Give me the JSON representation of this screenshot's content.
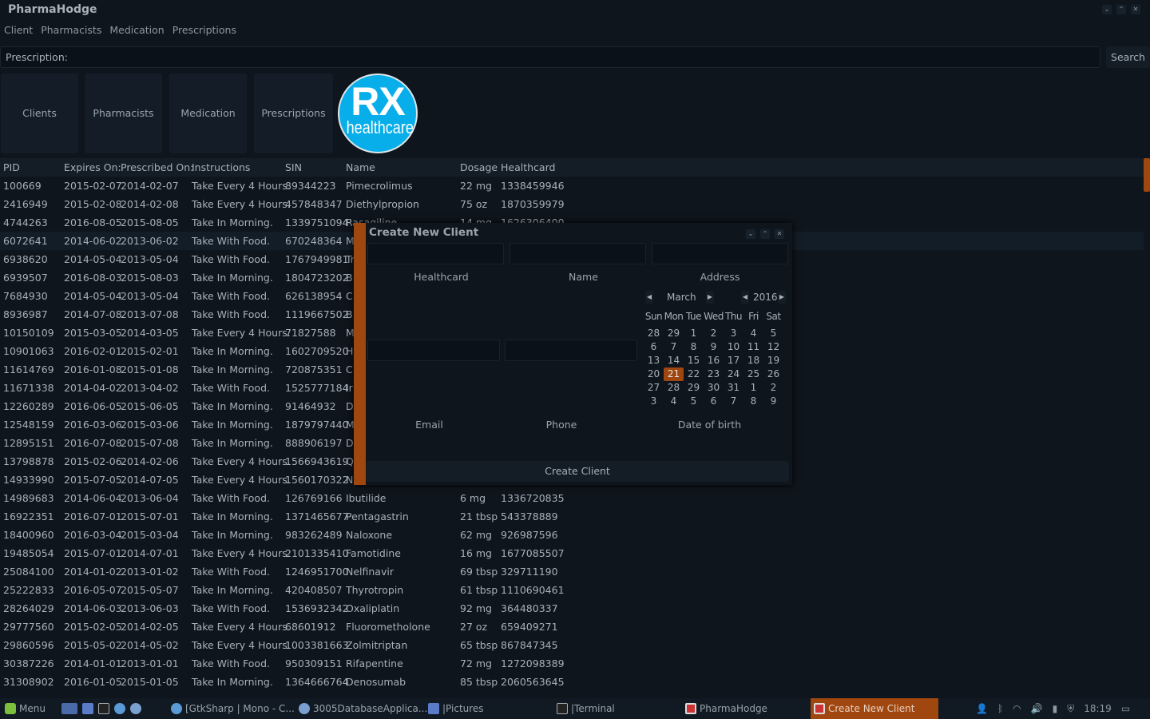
{
  "window": {
    "title": "PharmaHodge",
    "controls": [
      "minimize",
      "maximize",
      "close"
    ]
  },
  "menu": [
    "Client",
    "Pharmacists",
    "Medication",
    "Prescriptions"
  ],
  "search": {
    "label": "Prescription:",
    "value": "",
    "button": "Search"
  },
  "nav": [
    "Clients",
    "Pharmacists",
    "Medication",
    "Prescriptions"
  ],
  "logo": {
    "line1": "RX",
    "line2": "healthcare",
    "color": "#08aeea"
  },
  "table": {
    "headers": [
      "PID",
      "Expires On:",
      "Prescribed On:",
      "Instructions",
      "SIN",
      "Name",
      "Dosage",
      "Healthcard"
    ],
    "selected_index": 3,
    "rows": [
      [
        "100669",
        "2015-02-07",
        "2014-02-07",
        "Take Every 4 Hours.",
        "89344223",
        "Pimecrolimus",
        "22 mg",
        "1338459946"
      ],
      [
        "2416949",
        "2015-02-08",
        "2014-02-08",
        "Take Every 4 Hours.",
        "457848347",
        "Diethylpropion",
        "75 oz",
        "1870359979"
      ],
      [
        "4744263",
        "2016-08-05",
        "2015-08-05",
        "Take In Morning.",
        "1339751094",
        "Rasagiline",
        "14 mg",
        "1626306400"
      ],
      [
        "6072641",
        "2014-06-02",
        "2013-06-02",
        "Take With Food.",
        "670248364",
        "M",
        "",
        ""
      ],
      [
        "6938620",
        "2014-05-04",
        "2013-05-04",
        "Take With Food.",
        "1767949981",
        "Tr",
        "",
        ""
      ],
      [
        "6939507",
        "2016-08-03",
        "2015-08-03",
        "Take In Morning.",
        "1804723202",
        "B",
        "",
        ""
      ],
      [
        "7684930",
        "2014-05-04",
        "2013-05-04",
        "Take With Food.",
        "626138954",
        "C",
        "",
        ""
      ],
      [
        "8936987",
        "2014-07-08",
        "2013-07-08",
        "Take With Food.",
        "1119667502",
        "B",
        "",
        ""
      ],
      [
        "10150109",
        "2015-03-05",
        "2014-03-05",
        "Take Every 4 Hours.",
        "71827588",
        "M",
        "",
        ""
      ],
      [
        "10901063",
        "2016-02-01",
        "2015-02-01",
        "Take In Morning.",
        "1602709520",
        "H",
        "",
        ""
      ],
      [
        "11614769",
        "2016-01-08",
        "2015-01-08",
        "Take In Morning.",
        "720875351",
        "C",
        "",
        ""
      ],
      [
        "11671338",
        "2014-04-02",
        "2013-04-02",
        "Take With Food.",
        "1525777184",
        "Ir",
        "",
        ""
      ],
      [
        "12260289",
        "2016-06-05",
        "2015-06-05",
        "Take In Morning.",
        "91464932",
        "D",
        "",
        ""
      ],
      [
        "12548159",
        "2016-03-06",
        "2015-03-06",
        "Take In Morning.",
        "1879797440",
        "M",
        "",
        ""
      ],
      [
        "12895151",
        "2016-07-08",
        "2015-07-08",
        "Take In Morning.",
        "888906197",
        "D",
        "",
        ""
      ],
      [
        "13798878",
        "2015-02-06",
        "2014-02-06",
        "Take Every 4 Hours.",
        "1566943619",
        "Q",
        "",
        ""
      ],
      [
        "14933990",
        "2015-07-05",
        "2014-07-05",
        "Take Every 4 Hours.",
        "1560170322",
        "N",
        "",
        ""
      ],
      [
        "14989683",
        "2014-06-04",
        "2013-06-04",
        "Take With Food.",
        "126769166",
        "Ibutilide",
        "6 mg",
        "1336720835"
      ],
      [
        "16922351",
        "2016-07-01",
        "2015-07-01",
        "Take In Morning.",
        "1371465677",
        "Pentagastrin",
        "21 tbsp",
        "543378889"
      ],
      [
        "18400960",
        "2016-03-04",
        "2015-03-04",
        "Take In Morning.",
        "983262489",
        "Naloxone",
        "62 mg",
        "926987596"
      ],
      [
        "19485054",
        "2015-07-01",
        "2014-07-01",
        "Take Every 4 Hours.",
        "2101335410",
        "Famotidine",
        "16 mg",
        "1677085507"
      ],
      [
        "25084100",
        "2014-01-02",
        "2013-01-02",
        "Take With Food.",
        "1246951700",
        "Nelfinavir",
        "69 tbsp",
        "329711190"
      ],
      [
        "25222833",
        "2016-05-07",
        "2015-05-07",
        "Take In Morning.",
        "420408507",
        "Thyrotropin",
        "61 tbsp",
        "1110690461"
      ],
      [
        "28264029",
        "2014-06-03",
        "2013-06-03",
        "Take With Food.",
        "1536932342",
        "Oxaliplatin",
        "92 mg",
        "364480337"
      ],
      [
        "29777560",
        "2015-02-05",
        "2014-02-05",
        "Take Every 4 Hours.",
        "68601912",
        "Fluorometholone",
        "27 oz",
        "659409271"
      ],
      [
        "29860596",
        "2015-05-02",
        "2014-05-02",
        "Take Every 4 Hours.",
        "1003381663",
        "Zolmitriptan",
        "65 tbsp",
        "867847345"
      ],
      [
        "30387226",
        "2014-01-01",
        "2013-01-01",
        "Take With Food.",
        "950309151",
        "Rifapentine",
        "72 mg",
        "1272098389"
      ],
      [
        "31308902",
        "2016-01-05",
        "2015-01-05",
        "Take In Morning.",
        "1364666764",
        "Denosumab",
        "85 tbsp",
        "2060563645"
      ]
    ]
  },
  "dialog": {
    "title": "Create New Client",
    "labels": {
      "healthcard": "Healthcard",
      "name": "Name",
      "address": "Address",
      "email": "Email",
      "phone": "Phone",
      "dob": "Date of birth"
    },
    "calendar": {
      "month": "March",
      "year": "2016",
      "day_names": [
        "Sun",
        "Mon",
        "Tue",
        "Wed",
        "Thu",
        "Fri",
        "Sat"
      ],
      "weeks": [
        [
          "28",
          "29",
          "1",
          "2",
          "3",
          "4",
          "5"
        ],
        [
          "6",
          "7",
          "8",
          "9",
          "10",
          "11",
          "12"
        ],
        [
          "13",
          "14",
          "15",
          "16",
          "17",
          "18",
          "19"
        ],
        [
          "20",
          "21",
          "22",
          "23",
          "24",
          "25",
          "26"
        ],
        [
          "27",
          "28",
          "29",
          "30",
          "31",
          "1",
          "2"
        ],
        [
          "3",
          "4",
          "5",
          "6",
          "7",
          "8",
          "9"
        ]
      ],
      "selected": "21"
    },
    "button": "Create Client",
    "accent": "#a0460f"
  },
  "taskbar": {
    "menu": "Menu",
    "items": [
      "[GtkSharp | Mono - C...",
      "3005DatabaseApplica...",
      "|Pictures",
      "|Terminal",
      "PharmaHodge",
      "Create New Client"
    ],
    "active": "Create New Client",
    "clock": "18:19"
  }
}
